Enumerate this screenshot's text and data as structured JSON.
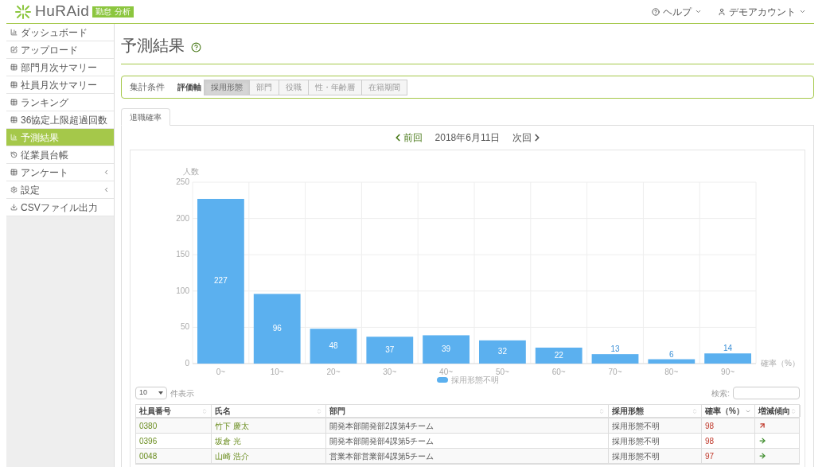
{
  "header": {
    "logo_text": "HuRAid",
    "badge": [
      "勤怠",
      "分析"
    ],
    "menus": [
      {
        "label": "ヘルプ",
        "kind": "help"
      },
      {
        "label": "デモアカウント",
        "kind": "user"
      }
    ]
  },
  "sidebar": {
    "items": [
      {
        "label": "ダッシュボード",
        "selected": false,
        "submenu": false
      },
      {
        "label": "アップロード",
        "selected": false,
        "submenu": false
      },
      {
        "label": "部門月次サマリー",
        "selected": false,
        "submenu": false
      },
      {
        "label": "社員月次サマリー",
        "selected": false,
        "submenu": false
      },
      {
        "label": "ランキング",
        "selected": false,
        "submenu": false
      },
      {
        "label": "36協定上限超過回数",
        "selected": false,
        "submenu": false
      },
      {
        "label": "予測結果",
        "selected": true,
        "submenu": false
      },
      {
        "label": "従業員台帳",
        "selected": false,
        "submenu": false
      },
      {
        "label": "アンケート",
        "selected": false,
        "submenu": true
      },
      {
        "label": "設定",
        "selected": false,
        "submenu": true
      },
      {
        "label": "CSVファイル出力",
        "selected": false,
        "submenu": false
      }
    ]
  },
  "page_title": "予測結果",
  "conditions": {
    "title": "集計条件",
    "axis_label": "評価軸",
    "options": [
      {
        "label": "採用形態",
        "selected": true
      },
      {
        "label": "部門",
        "selected": false
      },
      {
        "label": "役職",
        "selected": false
      },
      {
        "label": "性・年齢層",
        "selected": false
      },
      {
        "label": "在籍期間",
        "selected": false
      }
    ]
  },
  "tabs": [
    {
      "label": "退職確率",
      "selected": true
    }
  ],
  "date_nav": {
    "prev": "前回",
    "date": "2018年6月11日",
    "next": "次回"
  },
  "chart_data": {
    "type": "bar",
    "ylabel": "人数",
    "xlabel": "確率（%）",
    "categories": [
      "0~",
      "10~",
      "20~",
      "30~",
      "40~",
      "50~",
      "60~",
      "70~",
      "80~",
      "90~"
    ],
    "series": [
      {
        "name": "採用形態不明",
        "color": "#5bb0ef",
        "values": [
          227,
          96,
          48,
          37,
          39,
          32,
          22,
          13,
          6,
          14
        ]
      }
    ],
    "ylim": [
      0,
      250
    ],
    "yticks": [
      0,
      50,
      100,
      150,
      200,
      250
    ],
    "data_labels": true,
    "grid": true
  },
  "table": {
    "page_size": "10",
    "page_size_label": "件表示",
    "search_label": "検索:",
    "columns": [
      {
        "label": "社員番号",
        "sorted": false
      },
      {
        "label": "氏名",
        "sorted": false
      },
      {
        "label": "部門",
        "sorted": false
      },
      {
        "label": "採用形態",
        "sorted": false
      },
      {
        "label": "確率（%）",
        "sorted": true
      },
      {
        "label": "増減傾向",
        "sorted": false
      }
    ],
    "rows": [
      {
        "id": "0380",
        "name": "竹下 慶太",
        "dept": "開発本部開発部2課第4チーム",
        "type": "採用形態不明",
        "rate": "98",
        "trend_up": true
      },
      {
        "id": "0396",
        "name": "坂倉 光",
        "dept": "開発本部開発部4課第5チーム",
        "type": "採用形態不明",
        "rate": "98",
        "trend_up": false
      },
      {
        "id": "0048",
        "name": "山崎 浩介",
        "dept": "営業本部営業部4課第5チーム",
        "type": "採用形態不明",
        "rate": "97",
        "trend_up": false
      }
    ]
  }
}
